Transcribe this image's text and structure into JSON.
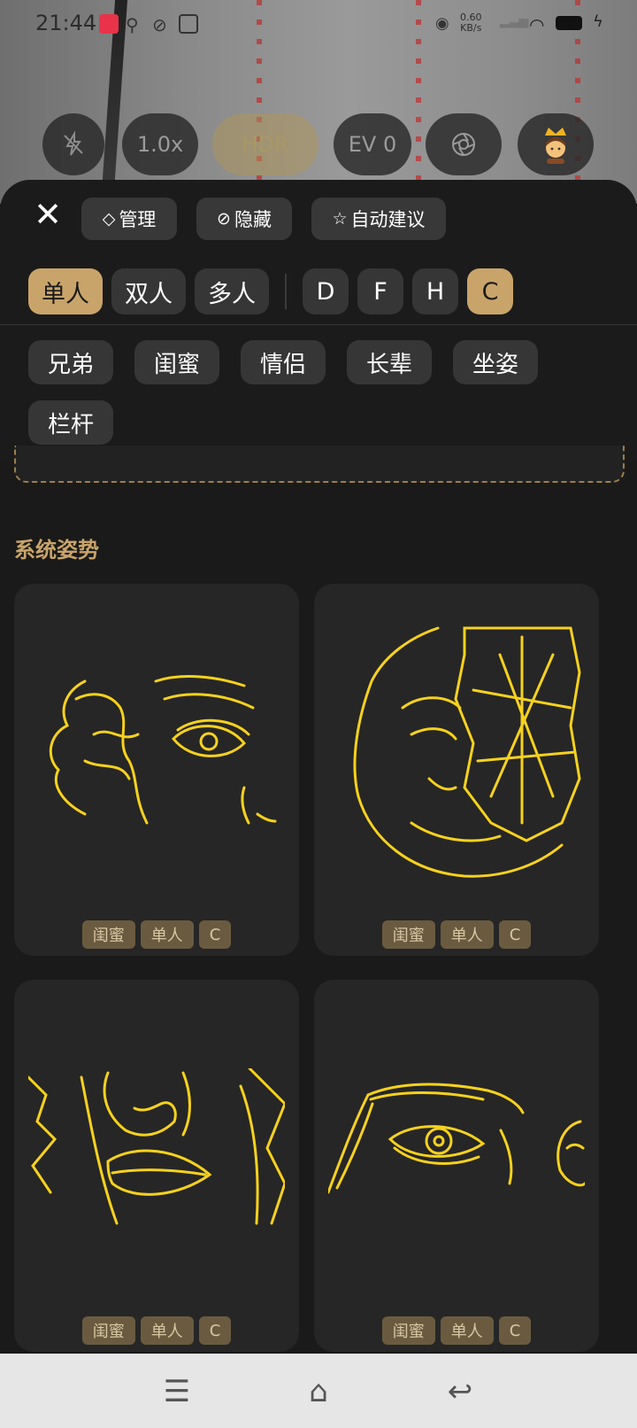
{
  "status_bar": {
    "time": "21:44",
    "net_speed_value": "0.60",
    "net_speed_unit": "KB/s"
  },
  "camera_controls": {
    "zoom": "1.0x",
    "hdr": "HDR",
    "ev": "EV 0"
  },
  "toolbar": {
    "manage": "管理",
    "hide": "隐藏",
    "auto_suggest": "自动建议"
  },
  "categories": {
    "people": [
      "单人",
      "双人",
      "多人"
    ],
    "letters": [
      "D",
      "F",
      "H",
      "C"
    ],
    "active_people": "单人",
    "active_letter": "C"
  },
  "sub_tags": [
    "兄弟",
    "闺蜜",
    "情侣",
    "长辈",
    "坐姿",
    "栏杆"
  ],
  "section_title": "系统姿势",
  "cards": [
    {
      "tags": [
        "闺蜜",
        "单人",
        "C"
      ]
    },
    {
      "tags": [
        "闺蜜",
        "单人",
        "C"
      ]
    },
    {
      "tags": [
        "闺蜜",
        "单人",
        "C"
      ]
    },
    {
      "tags": [
        "闺蜜",
        "单人",
        "C"
      ]
    }
  ],
  "colors": {
    "accent": "#c9a46a",
    "sketch": "#f7d21c",
    "sheet": "#1b1b1b"
  },
  "icons": [
    "close-icon",
    "tag-icon",
    "eye-off-icon",
    "star-icon",
    "flash-off-icon",
    "aperture-icon",
    "crown-avatar-icon",
    "menu-icon",
    "home-icon",
    "back-icon"
  ]
}
